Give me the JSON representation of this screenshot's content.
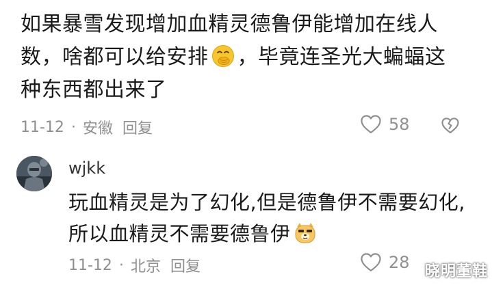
{
  "comment": {
    "line1": "如果暴雪发现增加血精灵德鲁伊能增加在线人",
    "line2a": "数，啥都可以给安排",
    "emoji1": "covering-mouth-laugh-emoji",
    "line2b": "，毕竟连圣光大蝙蝠这",
    "line3": "种东西都出来了",
    "date": "11-12",
    "dot": "·",
    "location": "安徽",
    "reply_label": "回复",
    "like_count": "58"
  },
  "reply": {
    "username": "wjkk",
    "line1": "玩血精灵是为了幻化,但是德鲁伊不需要幻化,",
    "line2": "所以血精灵不需要德鲁伊",
    "emoji2": "smug-dog-emoji",
    "date": "11-12",
    "dot": "·",
    "location": "北京",
    "reply_label": "回复",
    "like_count": "28"
  },
  "watermark": "晓明董鞋",
  "colors": {
    "text": "#1a1a1a",
    "meta": "#8f8f8f",
    "emoji_yellow": "#f7c52e"
  }
}
